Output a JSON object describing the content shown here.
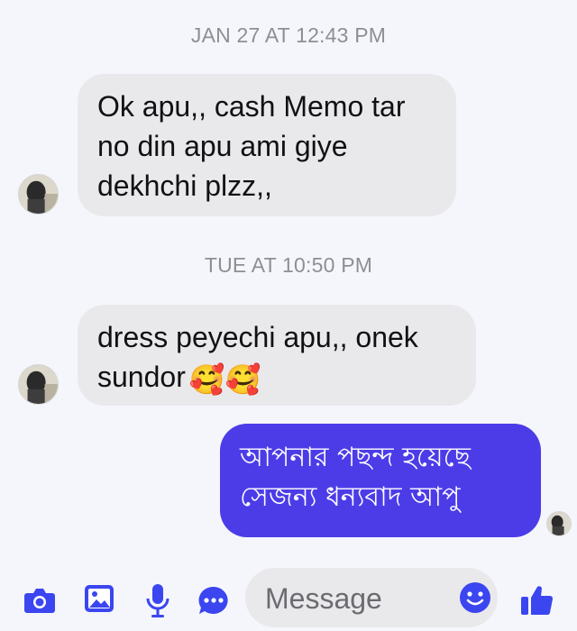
{
  "conversation": {
    "timestamps": [
      "JAN 27 AT 12:43 PM",
      "TUE AT 10:50 PM"
    ],
    "messages": [
      {
        "direction": "incoming",
        "lines": [
          "Ok apu,, cash Memo tar",
          "no din apu ami giye",
          "dekhchi plzz,,"
        ]
      },
      {
        "direction": "incoming",
        "lines": [
          "dress peyechi apu,,  onek",
          "sundor"
        ],
        "emoji": "🥰🥰"
      },
      {
        "direction": "outgoing",
        "lines": [
          "আপনার পছন্দ হয়েছে",
          "সেজন্য ধন্যবাদ আপু"
        ]
      }
    ]
  },
  "composer": {
    "placeholder": "Message",
    "icons": [
      "camera-icon",
      "photo-icon",
      "microphone-icon",
      "more-icon",
      "emoji-icon",
      "thumbs-up-icon"
    ]
  },
  "colors": {
    "background": "#f5f6fb",
    "incoming_bubble": "#e9e9ec",
    "outgoing_bubble": "#4c3ce8",
    "accent": "#3b46f0",
    "timestamp": "#8e8e93"
  }
}
